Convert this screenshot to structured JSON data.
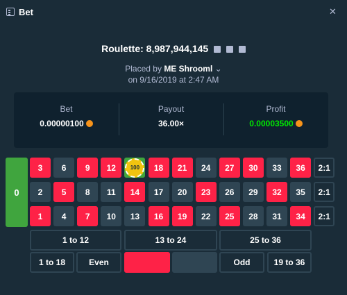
{
  "header": {
    "title": "Bet",
    "close_icon": "close-icon"
  },
  "game": {
    "label": "Roulette: 8,987,944,145",
    "icons": [
      "copy-icon",
      "facebook-icon",
      "twitter-icon"
    ]
  },
  "placed": {
    "prefix": "Placed by",
    "user": "ME Shrooml",
    "date": "on 9/16/2019 at 2:47 AM"
  },
  "stats": {
    "bet": {
      "label": "Bet",
      "value": "0.00000100"
    },
    "payout": {
      "label": "Payout",
      "value": "36.00×"
    },
    "profit": {
      "label": "Profit",
      "value": "0.00003500",
      "color": "#00e701"
    }
  },
  "table": {
    "zero": "0",
    "rows": [
      [
        "3",
        "6",
        "9",
        "12",
        "15",
        "18",
        "21",
        "24",
        "27",
        "30",
        "33",
        "36"
      ],
      [
        "2",
        "5",
        "8",
        "11",
        "14",
        "17",
        "20",
        "23",
        "26",
        "29",
        "32",
        "35"
      ],
      [
        "1",
        "4",
        "7",
        "10",
        "13",
        "16",
        "19",
        "22",
        "25",
        "28",
        "31",
        "34"
      ]
    ],
    "colors": [
      [
        "red",
        "black",
        "red",
        "red",
        "black",
        "red",
        "red",
        "black",
        "red",
        "red",
        "black",
        "red"
      ],
      [
        "black",
        "red",
        "black",
        "black",
        "red",
        "black",
        "black",
        "red",
        "black",
        "black",
        "red",
        "black"
      ],
      [
        "red",
        "black",
        "red",
        "black",
        "black",
        "red",
        "red",
        "black",
        "red",
        "black",
        "black",
        "red"
      ]
    ],
    "column_bets": [
      "2:1",
      "2:1",
      "2:1"
    ],
    "chip": {
      "number": "15",
      "value": "100"
    },
    "dozens": [
      "1 to 12",
      "13 to 24",
      "25 to 36"
    ],
    "bottom": {
      "low": "1 to 18",
      "even": "Even",
      "odd": "Odd",
      "high": "19 to 36"
    }
  }
}
